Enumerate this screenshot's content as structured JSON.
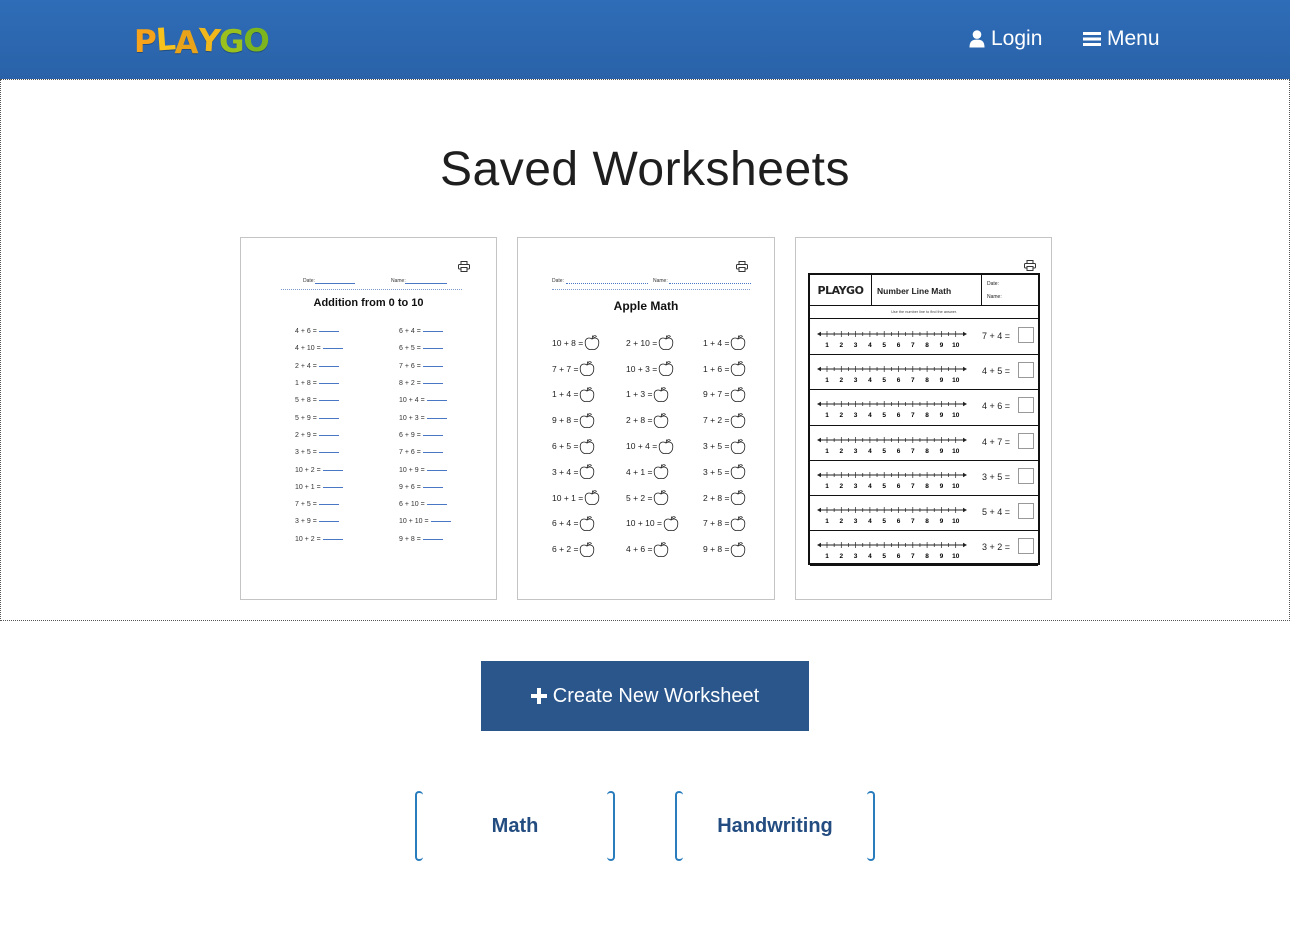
{
  "header": {
    "logo_letters": [
      "P",
      "L",
      "A",
      "Y",
      "G",
      "O"
    ],
    "login_label": "Login",
    "menu_label": "Menu"
  },
  "page": {
    "title": "Saved Worksheets"
  },
  "worksheets": [
    {
      "title": "Addition from 0 to 10",
      "date_label": "Date:",
      "name_label": "Name:",
      "left_column": [
        "4 + 6 =",
        "4 + 10 =",
        "2 + 4 =",
        "1 + 8 =",
        "5 + 8 =",
        "5 + 9 =",
        "2 + 9 =",
        "3 + 5 =",
        "10 + 2 =",
        "10 + 1 =",
        "7 + 5 =",
        "3 + 9 =",
        "10 + 2 ="
      ],
      "right_column": [
        "6 + 4 =",
        "6 + 5 =",
        "7 + 6 =",
        "8 + 2 =",
        "10 + 4 =",
        "10 + 3 =",
        "6 + 9 =",
        "7 + 6 =",
        "10 + 9 =",
        "9 + 6 =",
        "6 + 10 =",
        "10 + 10 =",
        "9 + 8 ="
      ]
    },
    {
      "title": "Apple Math",
      "date_label": "Date:",
      "name_label": "Name:",
      "column_1": [
        "10 + 8 =",
        "7 + 7 =",
        "1 + 4 =",
        "9 + 8 =",
        "6 + 5 =",
        "3 + 4 =",
        "10 + 1 =",
        "6 + 4 =",
        "6 + 2 ="
      ],
      "column_2": [
        "2 + 10 =",
        "10 + 3 =",
        "1 + 3 =",
        "2 + 8 =",
        "10 + 4 =",
        "4 + 1 =",
        "5 + 2 =",
        "10 + 10 =",
        "4 + 6 ="
      ],
      "column_3": [
        "1 + 4 =",
        "1 + 6 =",
        "9 + 7 =",
        "7 + 2 =",
        "3 + 5 =",
        "3 + 5 =",
        "2 + 8 =",
        "7 + 8 =",
        "9 + 8 ="
      ]
    },
    {
      "logo": "PLAYGO",
      "title": "Number Line Math",
      "date_label": "Date:",
      "name_label": "Name:",
      "instructions": "Use the number line to find the answer.",
      "number_line_labels": [
        "1",
        "2",
        "3",
        "4",
        "5",
        "6",
        "7",
        "8",
        "9",
        "10"
      ],
      "equations": [
        "7 + 4 =",
        "4 + 5 =",
        "4 + 6 =",
        "4 + 7 =",
        "3 + 5 =",
        "5 + 4 =",
        "3 + 2 ="
      ]
    }
  ],
  "actions": {
    "create_label": "Create New Worksheet"
  },
  "categories": [
    {
      "label": "Math"
    },
    {
      "label": "Handwriting"
    }
  ],
  "colors": {
    "header_bg": "#2c66b0",
    "create_button_bg": "#2a568c",
    "category_text": "#234c80",
    "category_bracket": "#2a7dbd"
  }
}
